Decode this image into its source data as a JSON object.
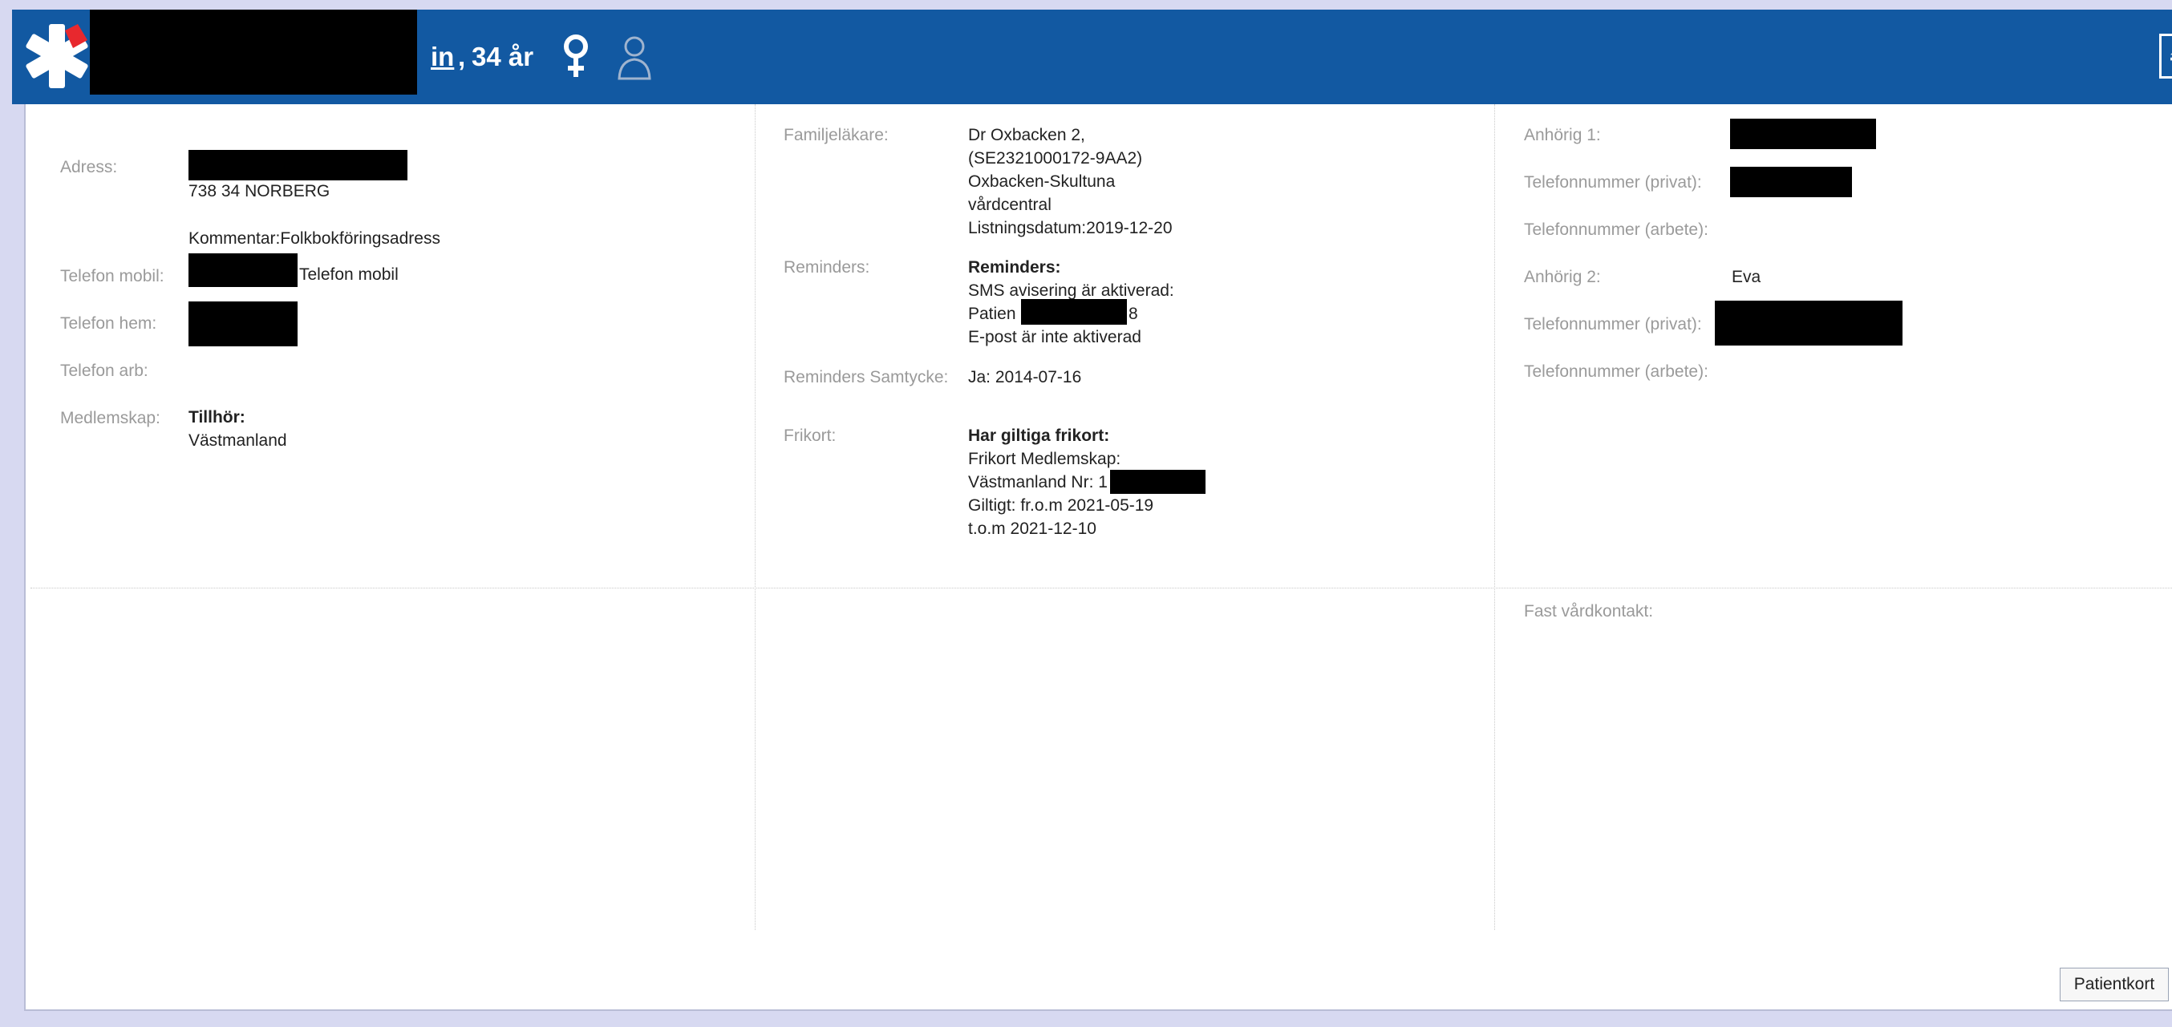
{
  "header": {
    "name_visible": "in",
    "comma": ",",
    "age": "34 år",
    "icons": [
      "star-of-life-icon",
      "female-icon",
      "person-icon",
      "eject-icon"
    ]
  },
  "col1": {
    "address_label": "Adress:",
    "address_postal": "738 34 NORBERG",
    "address_comment": "Kommentar:Folkbokföringsadress",
    "mobile_label": "Telefon mobil:",
    "mobile_type": "Telefon mobil",
    "home_label": "Telefon hem:",
    "work_label": "Telefon arb:",
    "membership_label": "Medlemskap:",
    "membership_title": "Tillhör:",
    "membership_value": "Västmanland"
  },
  "col2": {
    "doctor_label": "Familjeläkare:",
    "doctor_lines": [
      "Dr Oxbacken 2,",
      "(SE2321000172-9AA2)",
      "Oxbacken-Skultuna",
      "vårdcentral",
      "Listningsdatum:2019-12-20"
    ],
    "reminders_label": "Reminders:",
    "reminders_title": "Reminders:",
    "reminders_sms": "SMS avisering är aktiverad:",
    "reminders_patient": "Patien",
    "reminders_patient_tail": "8",
    "reminders_email": "E-post är inte aktiverad",
    "consent_label": "Reminders Samtycke:",
    "consent_value": "Ja: 2014-07-16",
    "frikort_label": "Frikort:",
    "frikort_title": "Har giltiga frikort:",
    "frikort_lines": [
      "Frikort Medlemskap:",
      "Västmanland Nr: 1",
      "Giltigt: fr.o.m 2021-05-19",
      "t.o.m 2021-12-10"
    ]
  },
  "col3": {
    "relative1_label": "Anhörig 1:",
    "phone_private1_label": "Telefonnummer (privat):",
    "phone_work1_label": "Telefonnummer (arbete):",
    "relative2_label": "Anhörig 2:",
    "relative2_value": "Eva",
    "phone_private2_label": "Telefonnummer (privat):",
    "phone_work2_label": "Telefonnummer (arbete):",
    "care_contact_label": "Fast vårdkontakt:"
  },
  "footer": {
    "patientkort_label": "Patientkort"
  },
  "colors": {
    "header_bg": "#1259a2",
    "page_bg": "#d7d9f1",
    "logo_accent": "#e8282e"
  }
}
